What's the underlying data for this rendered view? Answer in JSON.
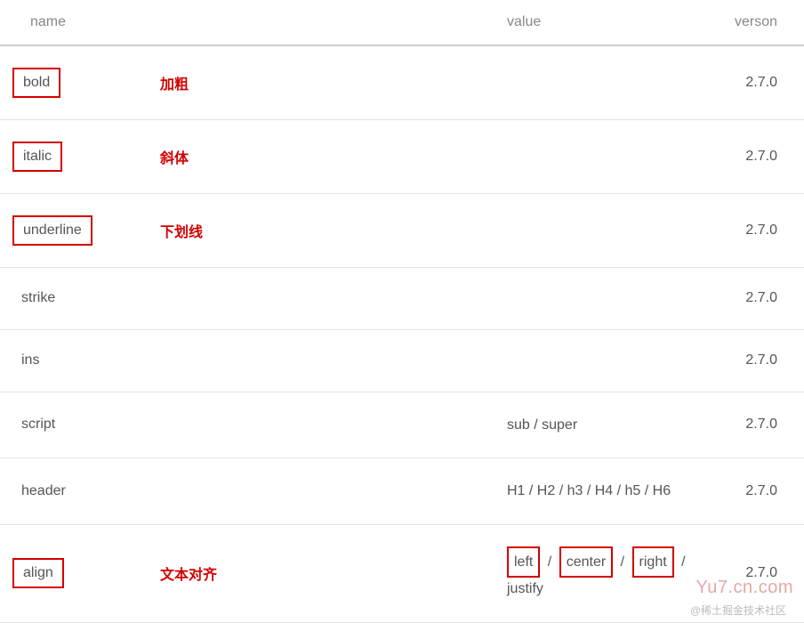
{
  "header": {
    "name": "name",
    "value": "value",
    "version": "verson"
  },
  "rows": [
    {
      "name": "bold",
      "name_boxed": true,
      "annotation": "加粗",
      "value_parts": [],
      "version": "2.7.0"
    },
    {
      "name": "italic",
      "name_boxed": true,
      "annotation": "斜体",
      "value_parts": [],
      "version": "2.7.0"
    },
    {
      "name": "underline",
      "name_boxed": true,
      "annotation": "下划线",
      "value_parts": [],
      "version": "2.7.0"
    },
    {
      "name": "strike",
      "name_boxed": false,
      "annotation": "",
      "value_parts": [],
      "version": "2.7.0"
    },
    {
      "name": "ins",
      "name_boxed": false,
      "annotation": "",
      "value_parts": [],
      "version": "2.7.0"
    },
    {
      "name": "script",
      "name_boxed": false,
      "annotation": "",
      "value_parts": [
        {
          "t": "sub / super",
          "boxed": false
        }
      ],
      "version": "2.7.0"
    },
    {
      "name": "header",
      "name_boxed": false,
      "annotation": "",
      "value_parts": [
        {
          "t": "H1 / H2 / h3 / H4 / h5 / H6",
          "boxed": false
        }
      ],
      "version": "2.7.0"
    },
    {
      "name": "align",
      "name_boxed": true,
      "annotation": "文本对齐",
      "value_parts": [
        {
          "t": "left",
          "boxed": true
        },
        {
          "t": "/",
          "sep": true
        },
        {
          "t": "center",
          "boxed": true
        },
        {
          "t": "/",
          "sep": true
        },
        {
          "t": "right",
          "boxed": true
        },
        {
          "t": "/",
          "sep": true
        },
        {
          "t": "justify",
          "boxed": false
        }
      ],
      "version": "2.7.0"
    }
  ],
  "watermarks": {
    "right": "Yu7.cn.com",
    "bottom": "@稀土掘金技术社区"
  }
}
